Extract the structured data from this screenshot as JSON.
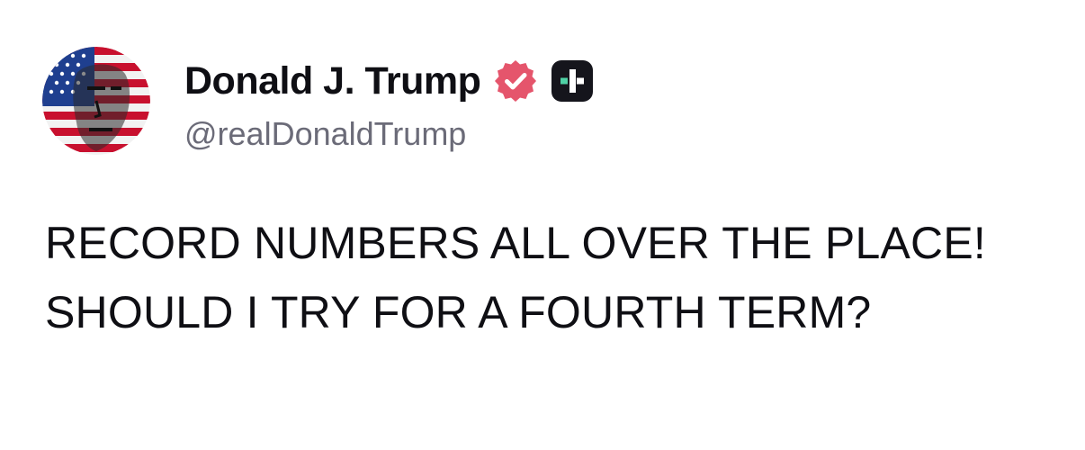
{
  "author": {
    "display_name": "Donald J. Trump",
    "handle": "@realDonaldTrump",
    "avatar_icon": "flag-portrait-avatar",
    "verified_icon": "verified-badge-icon",
    "plus_icon": "plus-badge-icon"
  },
  "post": {
    "text": "RECORD NUMBERS ALL OVER THE PLACE! SHOULD I TRY FOR A FOURTH TERM?"
  },
  "colors": {
    "verified_badge": "#e5556c",
    "plus_badge_bg": "#15151c",
    "plus_badge_accent": "#4fd1a5",
    "handle_text": "#6b6b78",
    "body_text": "#0f0f14"
  }
}
